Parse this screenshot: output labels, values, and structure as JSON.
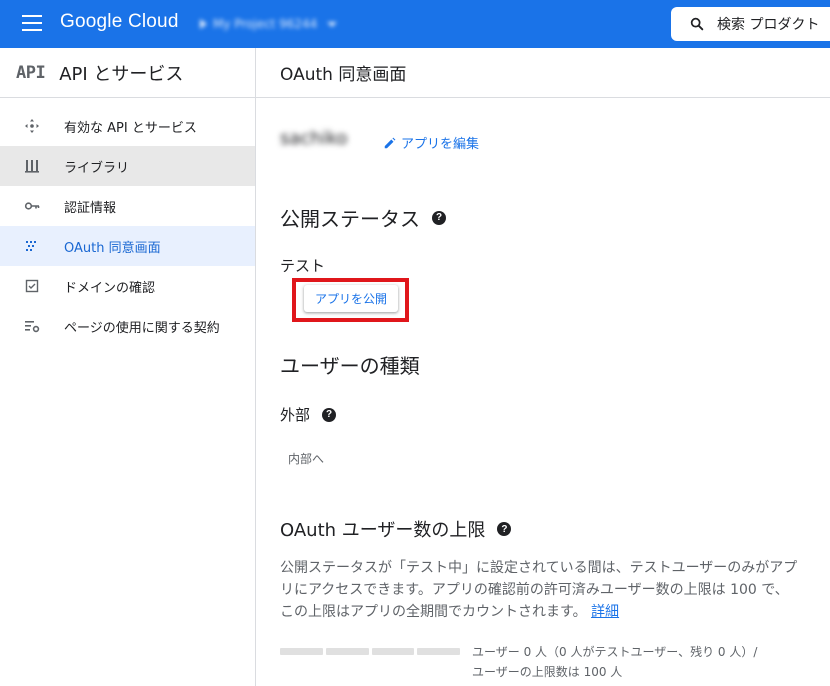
{
  "topbar": {
    "logo": "Google Cloud",
    "project": "My Project 96244",
    "search_label": "検索  プロダクト"
  },
  "sidebar": {
    "badge": "API",
    "title": "API とサービス",
    "items": [
      {
        "label": "有効な API とサービス",
        "icon": "enabled-apis-icon"
      },
      {
        "label": "ライブラリ",
        "icon": "library-icon"
      },
      {
        "label": "認証情報",
        "icon": "key-icon"
      },
      {
        "label": "OAuth 同意画面",
        "icon": "oauth-consent-icon"
      },
      {
        "label": "ドメインの確認",
        "icon": "checkbox-icon"
      },
      {
        "label": "ページの使用に関する契約",
        "icon": "settings-list-icon"
      }
    ]
  },
  "main": {
    "title": "OAuth 同意画面",
    "app_name": "sachiko",
    "edit_label": "アプリを編集",
    "publish_status": {
      "heading": "公開ステータス",
      "value": "テスト",
      "button": "アプリを公開"
    },
    "user_type": {
      "heading": "ユーザーの種類",
      "value": "外部",
      "button": "内部へ"
    },
    "user_cap": {
      "heading": "OAuth ユーザー数の上限",
      "description": "公開ステータスが「テスト中」に設定されている間は、テストユーザーのみがアプリにアクセスできます。アプリの確認前の許可済みユーザー数の上限は 100 で、この上限はアプリの全期間でカウントされます。",
      "learn_more": "詳細",
      "usage_line1": "ユーザー 0 人（0 人がテストユーザー、残り 0 人）/",
      "usage_line2": "ユーザーの上限数は 100 人",
      "progress": 0
    }
  },
  "colors": {
    "topbar": "#1a73e8",
    "link": "#1a73e8",
    "active_nav_bg": "#e8f0fe",
    "highlight_box": "#e0161b"
  }
}
